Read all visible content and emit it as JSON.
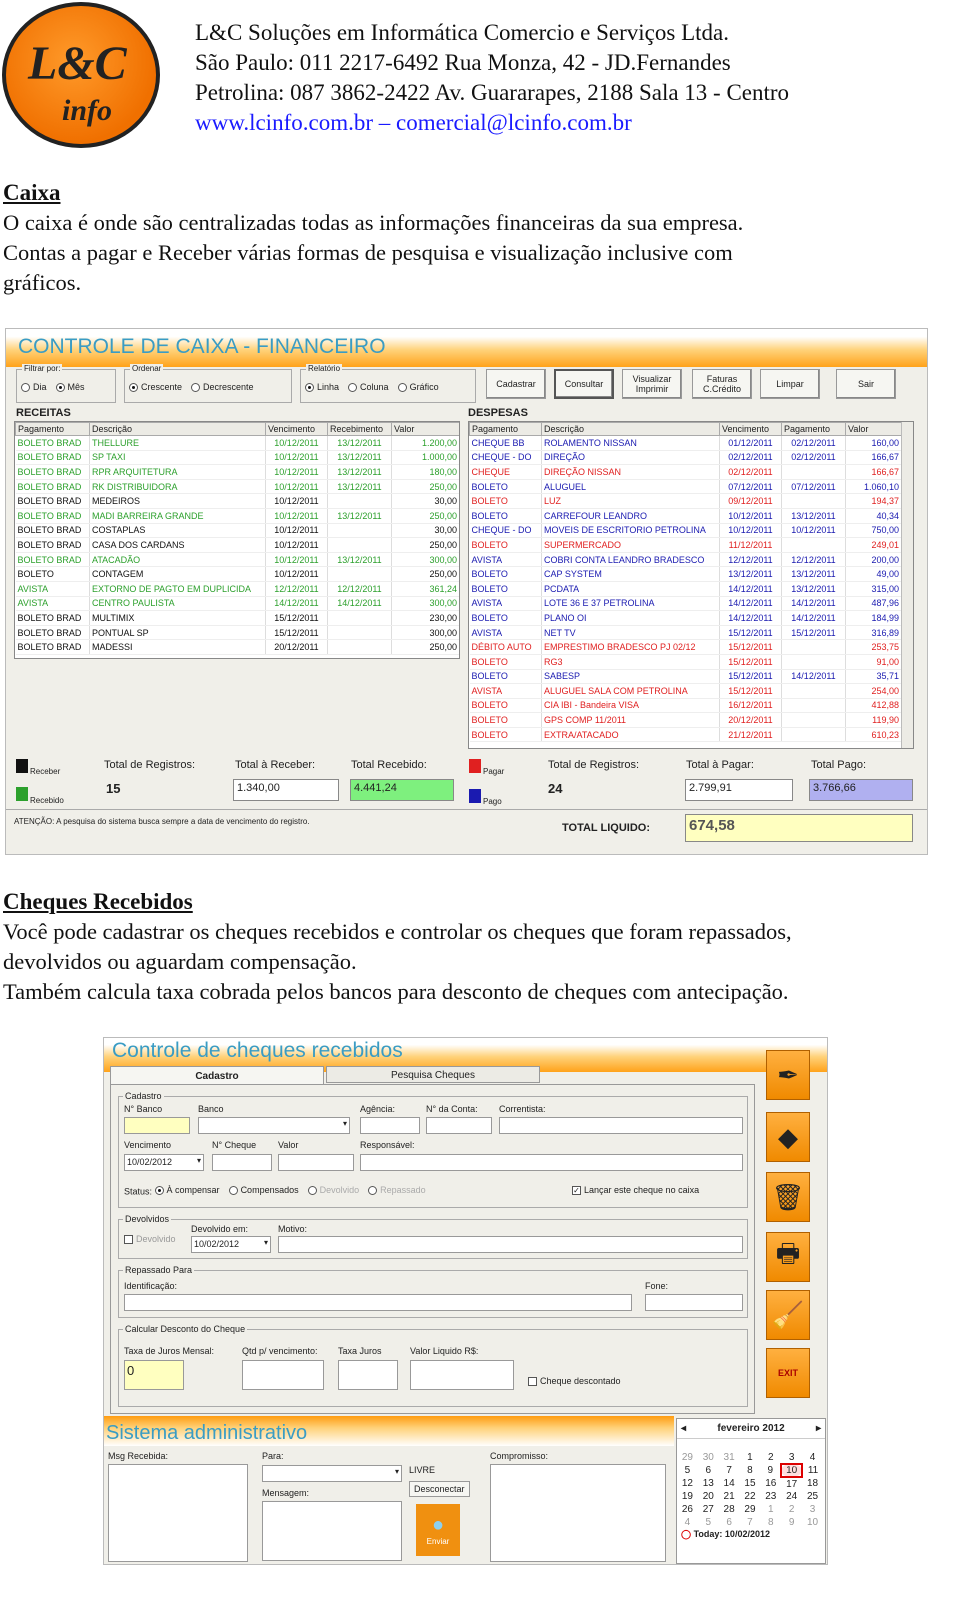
{
  "company": {
    "logo_text": "L&C",
    "logo_sub": "info",
    "lines": [
      "L&C Soluções em Informática Comercio e Serviços Ltda.",
      "São Paulo: 011 2217-6492 Rua Monza, 42  -  JD.Fernandes",
      "Petrolina:   087 3862-2422 Av. Guararapes, 2188 Sala 13 - Centro"
    ],
    "web": "www.lcinfo.com.br – comercial@lcinfo.com.br"
  },
  "caixa": {
    "heading": "Caixa",
    "lines": [
      "O caixa é onde são centralizadas todas as informações financeiras da sua empresa.",
      "Contas a pagar e Receber várias formas de pesquisa e visualização inclusive com",
      "gráficos."
    ]
  },
  "cheques_section": {
    "heading": "Cheques Recebidos",
    "lines": [
      "Você pode cadastrar os cheques recebidos e controlar os cheques que foram repassados,",
      "devolvidos ou aguardam compensação.",
      "Também calcula taxa cobrada pelos bancos para desconto de cheques com antecipação."
    ]
  },
  "caixa_app": {
    "title": "CONTROLE DE CAIXA - FINANCEIRO",
    "filtrar": {
      "legend": "Filtrar por:",
      "options": [
        "Dia",
        "Mês"
      ],
      "selected": "Mês"
    },
    "ordenar": {
      "legend": "Ordenar",
      "options": [
        "Crescente",
        "Decrescente"
      ],
      "selected": "Crescente"
    },
    "relatorio": {
      "legend": "Relatório",
      "options": [
        "Linha",
        "Coluna",
        "Gráfico"
      ],
      "selected": "Linha"
    },
    "buttons": [
      "Cadastrar",
      "Consultar",
      "Visualizar Imprimir",
      "Faturas C.Crédito",
      "Limpar",
      "Sair"
    ],
    "colors": {
      "recebido": "#2ca02c",
      "receber": "#111111",
      "pago": "#1a1ab0",
      "pagar": "#e02020"
    },
    "receitas": {
      "label": "RECEITAS",
      "columns": [
        "Pagamento",
        "Descrição",
        "Vencimento",
        "Recebimento",
        "Valor"
      ],
      "rows": [
        [
          "BOLETO BRAD",
          "THELLURE",
          "10/12/2011",
          "13/12/2011",
          "1.200,00",
          "recebido"
        ],
        [
          "BOLETO BRAD",
          "SP TAXI",
          "10/12/2011",
          "13/12/2011",
          "1.000,00",
          "recebido"
        ],
        [
          "BOLETO BRAD",
          "RPR ARQUITETURA",
          "10/12/2011",
          "13/12/2011",
          "180,00",
          "recebido"
        ],
        [
          "BOLETO BRAD",
          "RK DISTRIBUIDORA",
          "10/12/2011",
          "13/12/2011",
          "250,00",
          "recebido"
        ],
        [
          "BOLETO BRAD",
          "MEDEIROS",
          "10/12/2011",
          "",
          "30,00",
          "receber"
        ],
        [
          "BOLETO BRAD",
          "MADI BARREIRA GRANDE",
          "10/12/2011",
          "13/12/2011",
          "250,00",
          "recebido"
        ],
        [
          "BOLETO BRAD",
          "COSTAPLAS",
          "10/12/2011",
          "",
          "30,00",
          "receber"
        ],
        [
          "BOLETO BRAD",
          "CASA DOS CARDANS",
          "10/12/2011",
          "",
          "250,00",
          "receber"
        ],
        [
          "BOLETO BRAD",
          "ATACADÃO",
          "10/12/2011",
          "13/12/2011",
          "300,00",
          "recebido"
        ],
        [
          "BOLETO",
          "CONTAGEM",
          "10/12/2011",
          "",
          "250,00",
          "receber"
        ],
        [
          "AVISTA",
          "EXTORNO DE PAGTO EM DUPLICIDA",
          "12/12/2011",
          "12/12/2011",
          "361,24",
          "recebido"
        ],
        [
          "AVISTA",
          "CENTRO PAULISTA",
          "14/12/2011",
          "14/12/2011",
          "300,00",
          "recebido"
        ],
        [
          "BOLETO BRAD",
          "MULTIMIX",
          "15/12/2011",
          "",
          "230,00",
          "receber"
        ],
        [
          "BOLETO BRAD",
          "PONTUAL SP",
          "15/12/2011",
          "",
          "300,00",
          "receber"
        ],
        [
          "BOLETO BRAD",
          "MADESSI",
          "20/12/2011",
          "",
          "250,00",
          "receber"
        ]
      ]
    },
    "despesas": {
      "label": "DESPESAS",
      "columns": [
        "Pagamento",
        "Descrição",
        "Vencimento",
        "Pagamento",
        "Valor"
      ],
      "rows": [
        [
          "CHEQUE BB",
          "ROLAMENTO NISSAN",
          "01/12/2011",
          "02/12/2011",
          "160,00",
          "pago"
        ],
        [
          "CHEQUE - DO",
          "DIREÇÃO",
          "02/12/2011",
          "02/12/2011",
          "166,67",
          "pago"
        ],
        [
          "CHEQUE",
          "DIREÇÃO NISSAN",
          "02/12/2011",
          "",
          "166,67",
          "pagar"
        ],
        [
          "BOLETO",
          "ALUGUEL",
          "07/12/2011",
          "07/12/2011",
          "1.060,10",
          "pago"
        ],
        [
          "BOLETO",
          "LUZ",
          "09/12/2011",
          "",
          "194,37",
          "pagar"
        ],
        [
          "BOLETO",
          "CARREFOUR LEANDRO",
          "10/12/2011",
          "13/12/2011",
          "40,34",
          "pago"
        ],
        [
          "CHEQUE - DO",
          "MOVEIS DE ESCRITORIO PETROLINA",
          "10/12/2011",
          "10/12/2011",
          "750,00",
          "pago"
        ],
        [
          "BOLETO",
          "SUPERMERCADO",
          "11/12/2011",
          "",
          "249,01",
          "pagar"
        ],
        [
          "AVISTA",
          "COBRI CONTA LEANDRO BRADESCO",
          "12/12/2011",
          "12/12/2011",
          "200,00",
          "pago"
        ],
        [
          "BOLETO",
          "CAP SYSTEM",
          "13/12/2011",
          "13/12/2011",
          "49,00",
          "pago"
        ],
        [
          "BOLETO",
          "PCDATA",
          "14/12/2011",
          "13/12/2011",
          "315,00",
          "pago"
        ],
        [
          "AVISTA",
          "LOTE 36 E 37 PETROLINA",
          "14/12/2011",
          "14/12/2011",
          "487,96",
          "pago"
        ],
        [
          "BOLETO",
          "PLANO OI",
          "14/12/2011",
          "14/12/2011",
          "184,99",
          "pago"
        ],
        [
          "AVISTA",
          "NET TV",
          "15/12/2011",
          "15/12/2011",
          "316,89",
          "pago"
        ],
        [
          "DÉBITO AUTO",
          "EMPRESTIMO BRADESCO PJ 02/12",
          "15/12/2011",
          "",
          "253,75",
          "pagar"
        ],
        [
          "BOLETO",
          "RG3",
          "15/12/2011",
          "",
          "91,00",
          "pagar"
        ],
        [
          "BOLETO",
          "SABESP",
          "15/12/2011",
          "14/12/2011",
          "35,71",
          "pago"
        ],
        [
          "AVISTA",
          "ALUGUEL SALA COM PETROLINA",
          "15/12/2011",
          "",
          "254,00",
          "pagar"
        ],
        [
          "BOLETO",
          "CIA IBI - Bandeira VISA",
          "16/12/2011",
          "",
          "412,88",
          "pagar"
        ],
        [
          "BOLETO",
          "GPS COMP 11/2011",
          "20/12/2011",
          "",
          "119,90",
          "pagar"
        ],
        [
          "BOLETO",
          "EXTRA/ATACADO",
          "21/12/2011",
          "",
          "610,23",
          "pagar"
        ]
      ]
    },
    "legend": {
      "receber": "Receber",
      "recebido": "Recebido",
      "pagar": "Pagar",
      "pago": "Pago"
    },
    "totals_receitas": {
      "registros_label": "Total de Registros:",
      "registros": "15",
      "receber_label": "Total à Receber:",
      "receber": "1.340,00",
      "recebido_label": "Total Recebido:",
      "recebido": "4.441,24"
    },
    "totals_despesas": {
      "registros_label": "Total de Registros:",
      "registros": "24",
      "pagar_label": "Total à Pagar:",
      "pagar": "2.799,91",
      "pago_label": "Total Pago:",
      "pago": "3.766,66"
    },
    "notice": "ATENÇÃO: A pesquisa do sistema busca sempre a data de vencimento do registro.",
    "liquido_label": "TOTAL LIQUIDO:",
    "liquido": "674,58"
  },
  "cheques_app": {
    "title": "Controle de cheques recebidos",
    "tabs": [
      "Cadastro",
      "Pesquisa Cheques"
    ],
    "cadastro": {
      "legend": "Cadastro",
      "n_banco": "N° Banco",
      "banco": "Banco",
      "agencia": "Agência:",
      "conta": "N° da Conta:",
      "correntista": "Correntista:",
      "vencimento": "Vencimento",
      "vencimento_value": "10/02/2012",
      "n_cheque": "N° Cheque",
      "valor": "Valor",
      "responsavel": "Responsável:",
      "status_label": "Status:",
      "status_options": [
        "À compensar",
        "Compensados",
        "Devolvido",
        "Repassado"
      ],
      "status_selected": "À compensar",
      "lancar": "Lançar este cheque no caixa",
      "lancar_checked": true
    },
    "devolvidos": {
      "legend": "Devolvidos",
      "checkbox": "Devolvido",
      "devolvido_em": "Devolvido em:",
      "date": "10/02/2012",
      "motivo": "Motivo:"
    },
    "repassado": {
      "legend": "Repassado Para",
      "identificacao": "Identificação:",
      "fone": "Fone:"
    },
    "desconto": {
      "legend": "Calcular Desconto do Cheque",
      "taxa": "Taxa de Juros Mensal:",
      "taxa_value": "0",
      "qtd": "Qtd p/ vencimento:",
      "juros": "Taxa Juros",
      "liquido": "Valor Liquido R$:",
      "descontado": "Cheque descontado"
    },
    "side_icons": [
      "pen-icon",
      "shapes-icon",
      "trash-icon",
      "printer-icon",
      "broom-icon",
      "exit-icon"
    ],
    "exit_label": "EXIT"
  },
  "admin_app": {
    "title": "Sistema administrativo",
    "msg_recebida": "Msg Recebida:",
    "para": "Para:",
    "status": "LIVRE",
    "desconectar": "Desconectar",
    "mensagem": "Mensagem:",
    "enviar": "Enviar",
    "compromisso": "Compromisso:",
    "calendar": {
      "month": "fevereiro 2012",
      "weeks": [
        [
          "29",
          "30",
          "31",
          "1",
          "2",
          "3",
          "4"
        ],
        [
          "5",
          "6",
          "7",
          "8",
          "9",
          "10",
          "11"
        ],
        [
          "12",
          "13",
          "14",
          "15",
          "16",
          "17",
          "18"
        ],
        [
          "19",
          "20",
          "21",
          "22",
          "23",
          "24",
          "25"
        ],
        [
          "26",
          "27",
          "28",
          "29",
          "1",
          "2",
          "3"
        ],
        [
          "4",
          "5",
          "6",
          "7",
          "8",
          "9",
          "10"
        ]
      ],
      "selected": "10",
      "today": "Today: 10/02/2012"
    }
  }
}
